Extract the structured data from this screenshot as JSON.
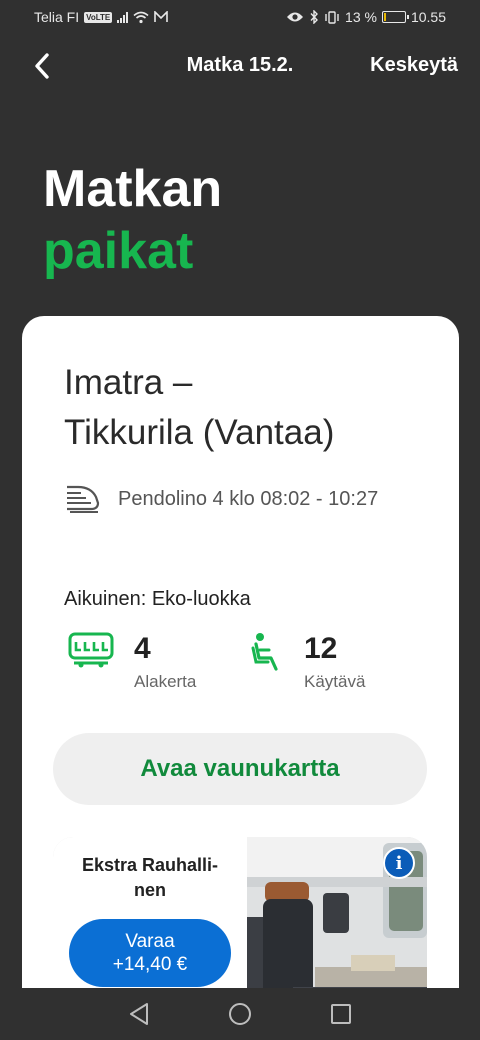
{
  "status_bar": {
    "carrier": "Telia FI",
    "volte": "VoLTE",
    "battery": "13 %",
    "battery_level": 0.13,
    "time": "10.55"
  },
  "nav": {
    "title": "Matka 15.2.",
    "cancel_label": "Keskeytä"
  },
  "heading": {
    "line1": "Matkan",
    "line2": "paikat"
  },
  "card": {
    "route": "Imatra –\nTikkurila (Vantaa)",
    "train_info": "Pendolino 4 klo 08:02 - 10:27",
    "passenger_class": "Aikuinen: Eko-luokka",
    "car_number": "4",
    "car_detail": "Alakerta",
    "seat_number": "12",
    "seat_detail": "Käytävä",
    "open_map_label": "Avaa vaunukartta"
  },
  "upgrade": {
    "name": "Ekstra Rauhalli-nen",
    "book_label": "Varaa",
    "book_price": "+14,40 €",
    "info_label": "i"
  },
  "colors": {
    "background": "#303030",
    "accent_green": "#17b64f",
    "button_blue": "#0b6fd4"
  }
}
